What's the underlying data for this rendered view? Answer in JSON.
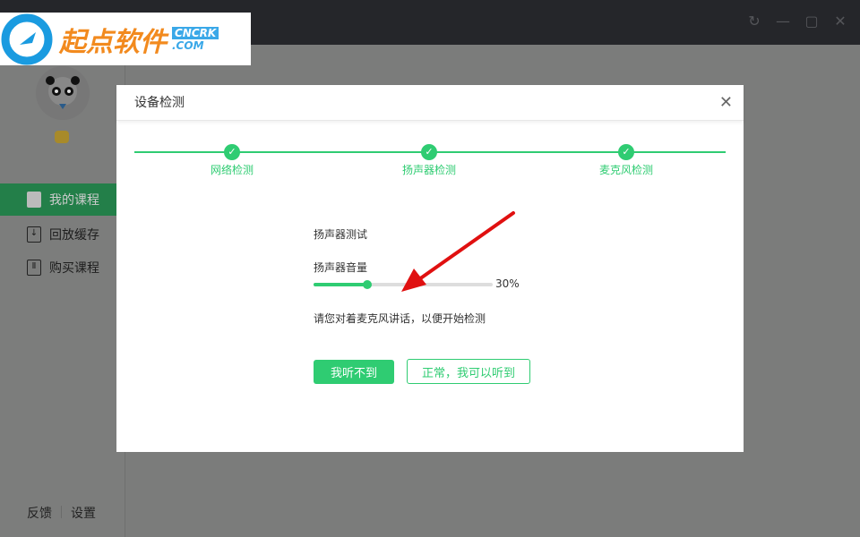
{
  "window": {
    "refresh_icon": "↻",
    "minimize_icon": "—",
    "maximize_icon": "▢",
    "close_icon": "✕"
  },
  "watermark": {
    "brand": "起点软件",
    "domain_top": "CNCRK",
    "domain_bottom": ".COM"
  },
  "sidebar": {
    "items": [
      {
        "label": "我的课程",
        "active": true
      },
      {
        "label": "回放缓存"
      },
      {
        "label": "购买课程"
      }
    ],
    "footer": [
      "反馈",
      "设置"
    ]
  },
  "dialog": {
    "title": "设备检测",
    "steps": [
      "网络检测",
      "扬声器检测",
      "麦克风检测"
    ],
    "section_title": "扬声器测试",
    "volume_label": "扬声器音量",
    "volume_percent": 30,
    "volume_text": "30%",
    "instruction": "请您对着麦克风讲话，以便开始检测",
    "btn_cannot_hear": "我听不到",
    "btn_can_hear": "正常，我可以听到"
  },
  "colors": {
    "accent": "#2fcc72",
    "arrow": "#e01010"
  }
}
